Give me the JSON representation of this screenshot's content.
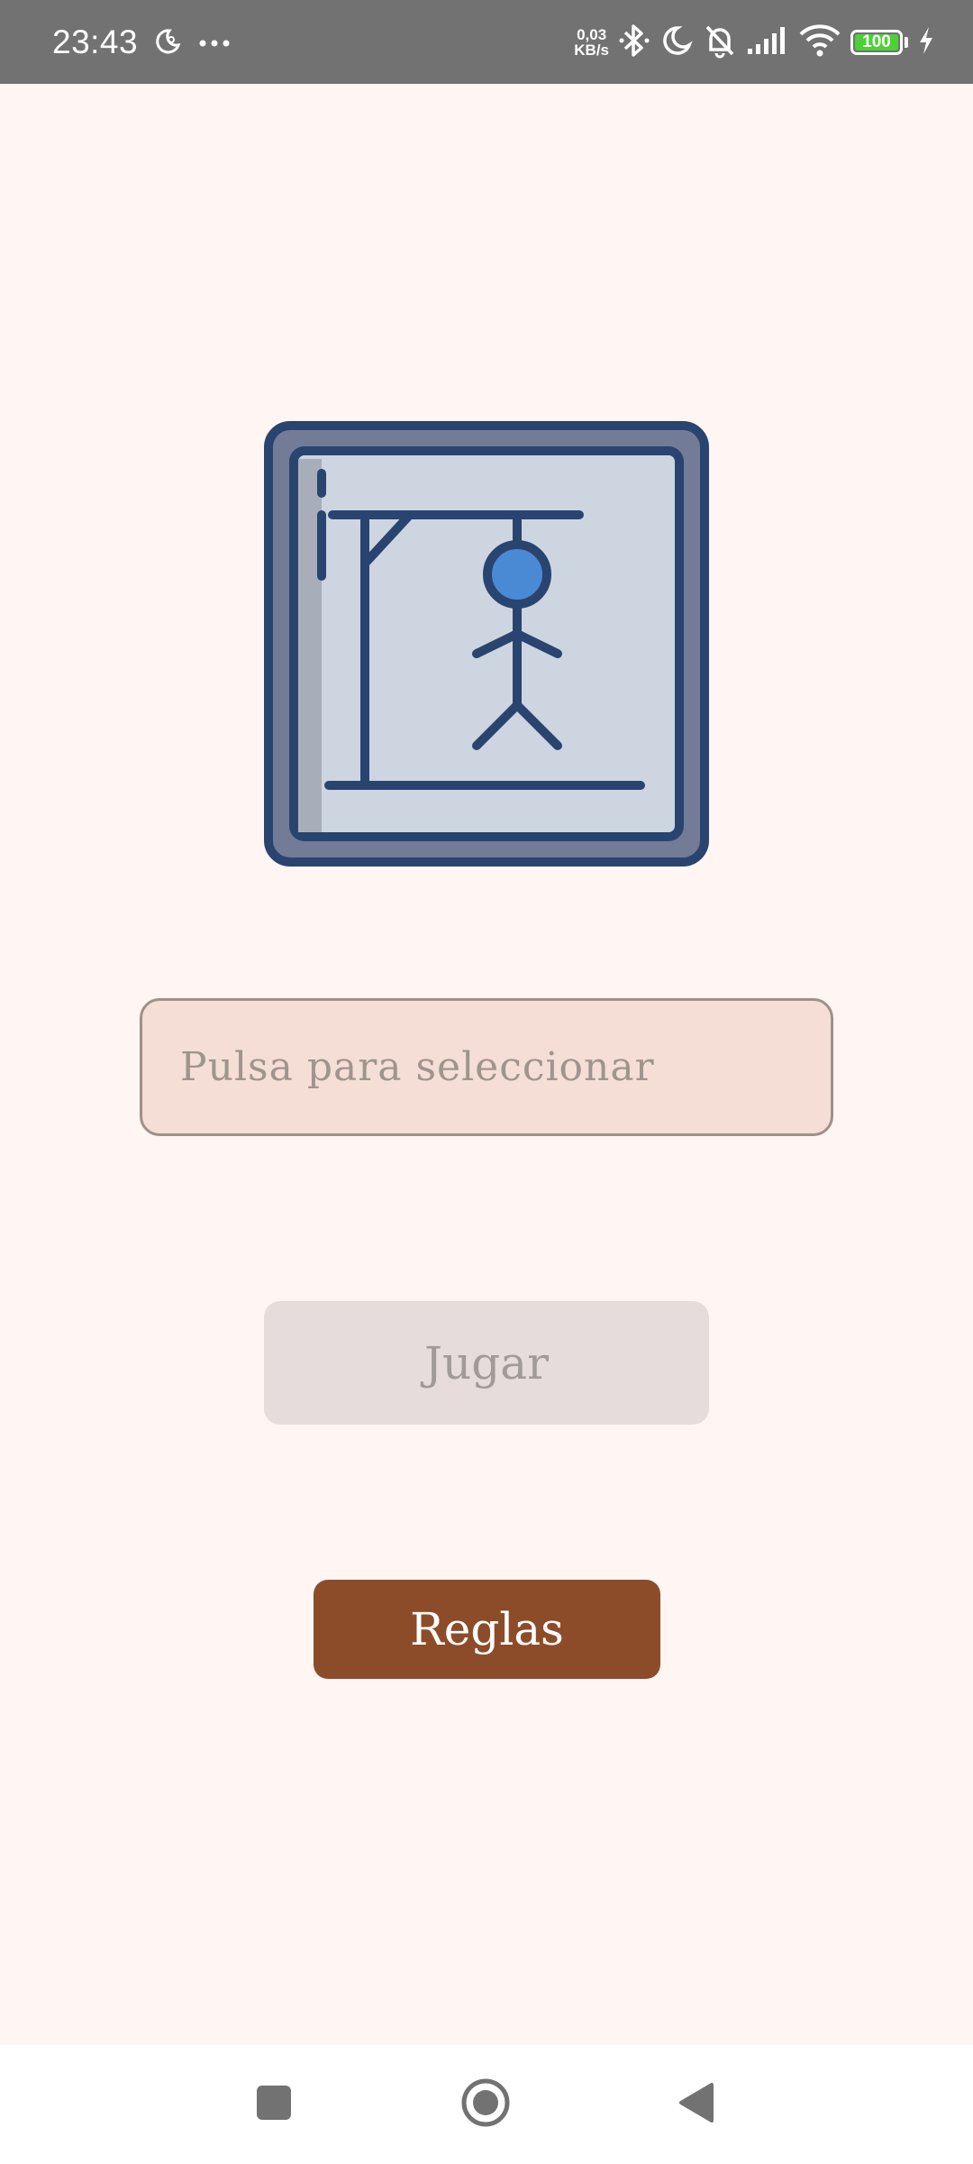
{
  "status_bar": {
    "time": "23:43",
    "net_speed_value": "0,03",
    "net_speed_unit": "KB/s",
    "battery_level": "100",
    "colors": {
      "background": "#727272",
      "battery": "#4CD137"
    }
  },
  "main": {
    "select_placeholder": "Pulsa para seleccionar",
    "play_label": "Jugar",
    "rules_label": "Reglas"
  },
  "colors": {
    "background": "#FFF5F3",
    "field": "#F5DED5",
    "play_disabled": "#E5DCDB",
    "rules": "#8C4C2A",
    "logo_outline": "#2A4470",
    "logo_head": "#4A8AD4"
  },
  "icons": {
    "status_left": [
      "moon-clock-icon",
      "more-icon"
    ],
    "status_right": [
      "bluetooth-icon",
      "do-not-disturb-icon",
      "bell-off-icon",
      "signal-icon",
      "wifi-icon",
      "battery-icon",
      "charging-icon"
    ],
    "nav": [
      "recents-icon",
      "home-icon",
      "back-icon"
    ]
  }
}
